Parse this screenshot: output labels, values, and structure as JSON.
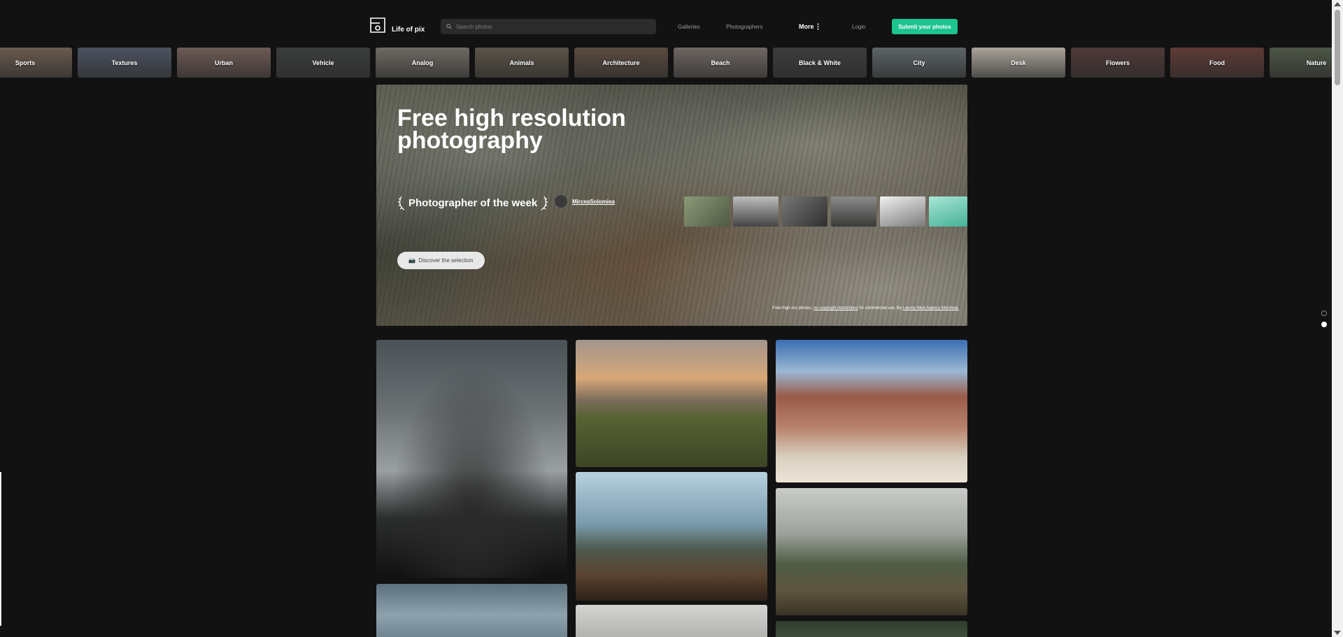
{
  "header": {
    "logo_text": "Life of pix",
    "search_placeholder": "Search photos",
    "nav": [
      "Galleries",
      "Photographers"
    ],
    "more_label": "More",
    "login_label": "Login",
    "submit_label": "Submit your photos"
  },
  "categories": [
    {
      "label": "Sports",
      "color": "#6b5a4e"
    },
    {
      "label": "Textures",
      "color": "#4c5360"
    },
    {
      "label": "Urban",
      "color": "#6d5a55"
    },
    {
      "label": "Vehicle",
      "color": "#3a3e3b"
    },
    {
      "label": "Analog",
      "color": "#6f6a63"
    },
    {
      "label": "Animals",
      "color": "#5c5448"
    },
    {
      "label": "Architecture",
      "color": "#5a4b40"
    },
    {
      "label": "Beach",
      "color": "#6f6762"
    },
    {
      "label": "Black & White",
      "color": "#3d3d3d"
    },
    {
      "label": "City",
      "color": "#5c6466"
    },
    {
      "label": "Desk",
      "color": "#aaa49a"
    },
    {
      "label": "Flowers",
      "color": "#4e3a38"
    },
    {
      "label": "Food",
      "color": "#5e3a36"
    },
    {
      "label": "Nature",
      "color": "#4c5546"
    }
  ],
  "hero": {
    "title": "Free high resolution photography",
    "potw_label": "Photographer of the week",
    "photographer": "MirceaSolomiea",
    "discover_label": "Discover the selection",
    "credit_prefix": "Free high-res photos,",
    "credit_link": "no copyright restrictions",
    "credit_mid": "for commercial use. By",
    "credit_agency": "Leeroy Web Agency Montreal.",
    "thumbs": [
      "#6f7a60",
      "#8a8a8a",
      "#5b5b5b",
      "#4a4a48",
      "#cfcfcf",
      "#7ec9b6"
    ]
  },
  "colors": {
    "accent": "#1ec48f",
    "background": "#121212"
  }
}
